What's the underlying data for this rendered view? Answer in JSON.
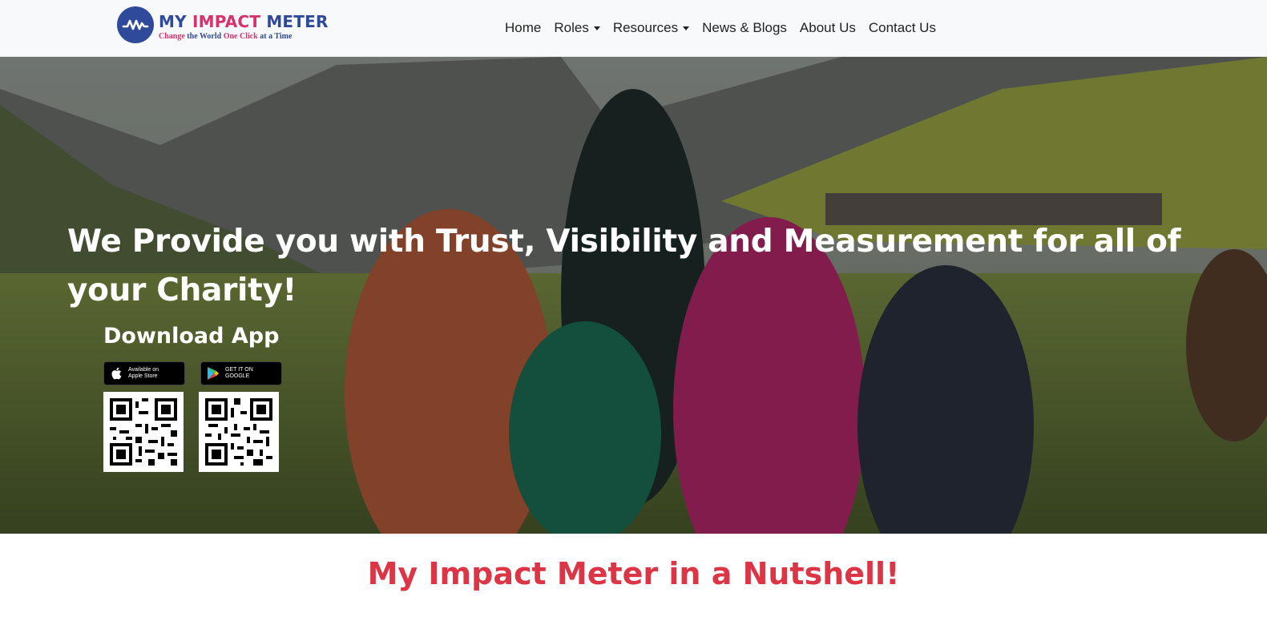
{
  "logo": {
    "title_part1": "MY",
    "title_part2": "IMPACT",
    "title_part3": "METER",
    "tag_word1": "Change",
    "tag_word2": "the World",
    "tag_word3": "One Click",
    "tag_word4": "at a Time"
  },
  "nav": {
    "items": [
      {
        "label": "Home"
      },
      {
        "label": "Roles"
      },
      {
        "label": "Resources"
      },
      {
        "label": "News & Blogs"
      },
      {
        "label": "About Us"
      },
      {
        "label": "Contact Us"
      }
    ]
  },
  "hero": {
    "headline": "We Provide you with Trust, Visibility and Measurement for all of your Charity!",
    "download_title": "Download App",
    "apple_badge": {
      "line1": "Available on",
      "line2": "Apple Store"
    },
    "google_badge": {
      "line1": "GET IT ON",
      "line2": "GOOGLE"
    }
  },
  "section": {
    "title": "My Impact Meter in a Nutshell!"
  },
  "colors": {
    "brand_blue": "#2f4a9a",
    "brand_pink": "#d6336c",
    "section_title": "#dc3545",
    "navbar_bg": "#f8f9fa"
  }
}
